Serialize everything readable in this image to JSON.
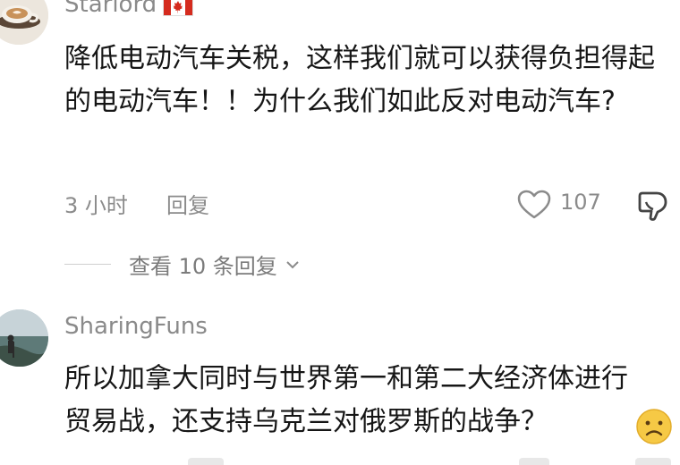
{
  "comment1": {
    "username": "Starlord",
    "flag_colors": {
      "red": "#d52b1e",
      "white": "#ffffff"
    },
    "text": "降低电动汽车关税，这样我们就可以获得负担得起的电动汽车！！为什么我们如此反对电动汽车?",
    "time": "3 小时",
    "reply_label": "回复",
    "like_count": "107",
    "view_replies": "查看 10 条回复"
  },
  "comment2": {
    "username": "SharingFuns",
    "text": "所以加拿大同时与世界第一和第二大经济体进行贸易战，还支持乌克兰对俄罗斯的战争？",
    "emoji": "frowning-face"
  },
  "colors": {
    "text": "#161616",
    "muted": "#8b8b8b",
    "emoji": "#f6c945"
  }
}
